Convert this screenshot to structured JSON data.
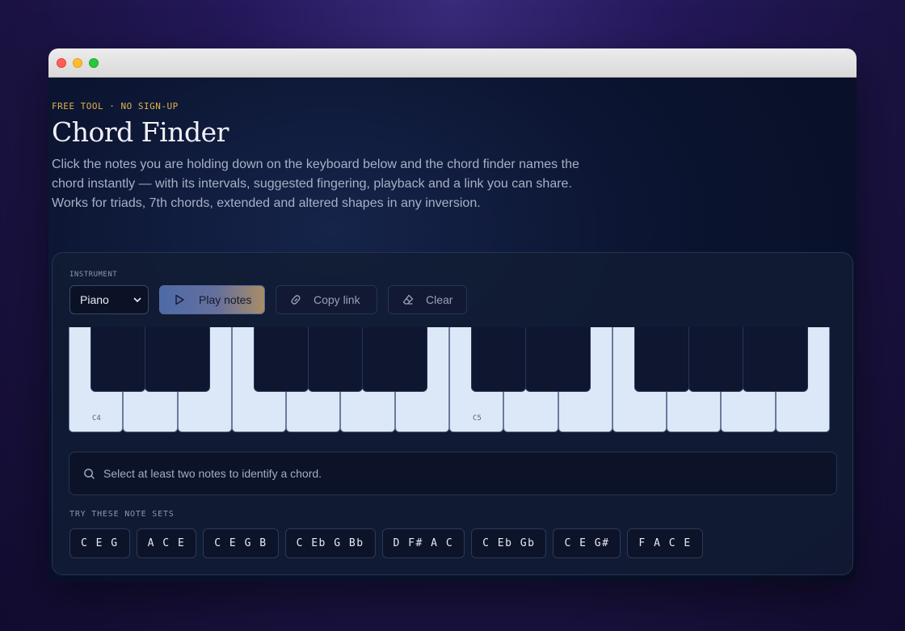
{
  "page": {
    "eyebrow": "FREE TOOL · NO SIGN-UP",
    "title": "Chord Finder",
    "description": "Click the notes you are holding down on the keyboard below and the chord finder names the chord instantly — with its intervals, suggested fingering, playback and a link you can share. Works for triads, 7th chords, extended and altered shapes in any inversion."
  },
  "controls": {
    "instrument_label": "INSTRUMENT",
    "instrument_value": "Piano",
    "play_label": "Play notes",
    "copy_label": "Copy link",
    "clear_label": "Clear"
  },
  "keyboard": {
    "labels": {
      "c4": "C4",
      "c5": "C5"
    }
  },
  "status": {
    "message": "Select at least two notes to identify a chord."
  },
  "presets": {
    "label": "TRY THESE NOTE SETS",
    "items": [
      "C E G",
      "A C E",
      "C E G B",
      "C Eb G Bb",
      "D F# A C",
      "C Eb Gb",
      "C E G#",
      "F A C E"
    ]
  },
  "icons": {
    "play": "play-icon",
    "link": "link-icon",
    "eraser": "eraser-icon",
    "search": "search-icon",
    "chevron": "chevron-down-icon"
  }
}
